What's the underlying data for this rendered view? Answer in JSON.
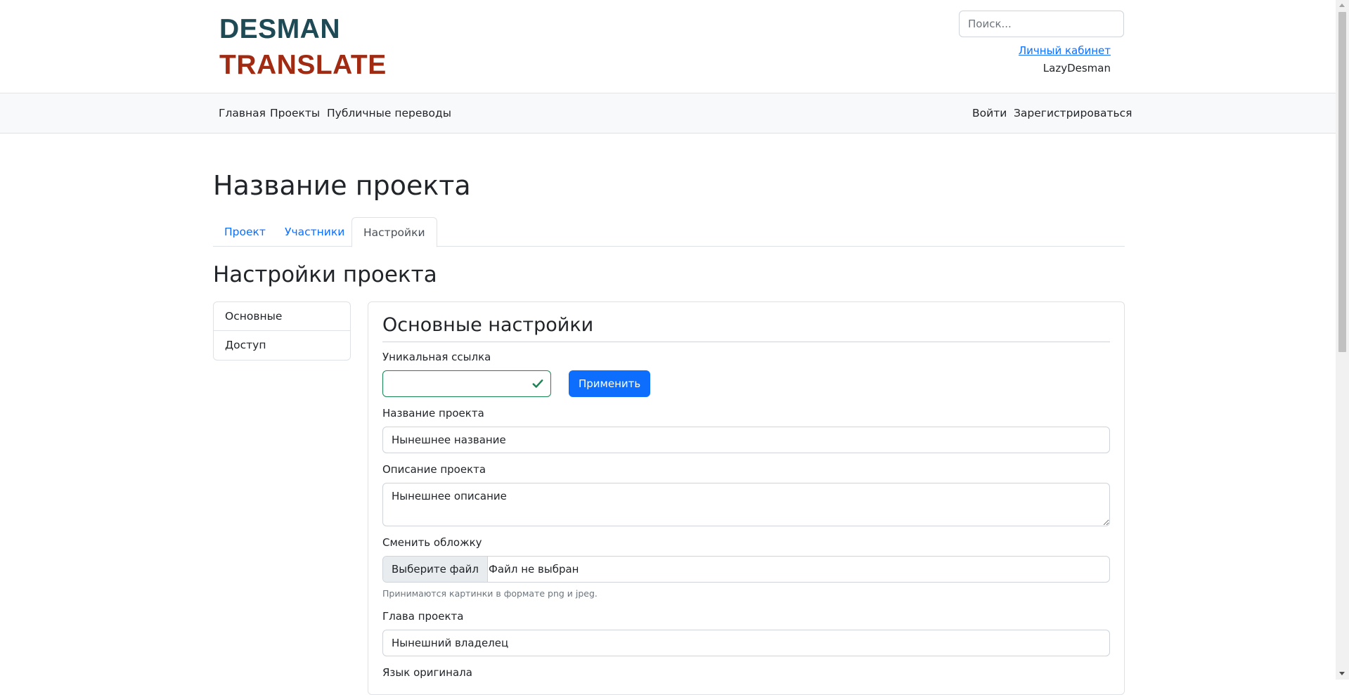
{
  "brand": {
    "line1": "DESMAN",
    "line2": "TRANSLATE",
    "color1": "#1e4a55",
    "color2": "#a12a13"
  },
  "header": {
    "search_placeholder": "Поиск...",
    "cabinet_link": "Личный кабинет",
    "username": "LazyDesman"
  },
  "nav": {
    "left": [
      "Главная",
      "Проекты",
      "Публичные переводы"
    ],
    "right": [
      "Войти",
      "Зарегистрироваться"
    ]
  },
  "page": {
    "title": "Название проекта",
    "tabs": [
      {
        "label": "Проект",
        "active": false
      },
      {
        "label": "Участники",
        "active": false
      },
      {
        "label": "Настройки",
        "active": true
      }
    ],
    "section_title": "Настройки проекта"
  },
  "sidebar": {
    "items": [
      "Основные",
      "Доступ"
    ]
  },
  "settings": {
    "title": "Основные настройки",
    "unique_link": {
      "label": "Уникальная ссылка",
      "value": "",
      "apply_label": "Применить"
    },
    "project_name": {
      "label": "Название проекта",
      "value": "Нынешнее название"
    },
    "description": {
      "label": "Описание проекта",
      "value": "Нынешнее описание"
    },
    "cover": {
      "label": "Сменить обложку",
      "button_label": "Выберите файл",
      "status": "Файл не выбран",
      "help": "Принимаются картинки в формате png и jpeg."
    },
    "owner": {
      "label": "Глава проекта",
      "value": "Нынешний владелец"
    },
    "language": {
      "label": "Язык оригинала"
    }
  },
  "colors": {
    "primary": "#0d6efd",
    "valid": "#198754",
    "navbar_bg": "#f8f9fa"
  }
}
